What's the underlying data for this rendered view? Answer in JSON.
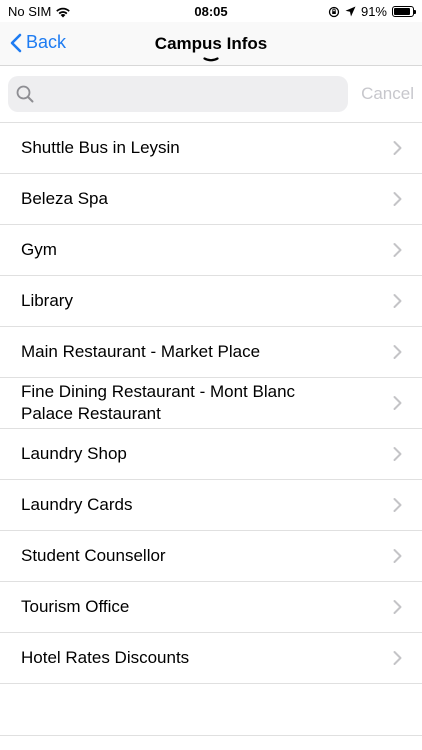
{
  "status_bar": {
    "carrier": "No SIM",
    "time": "08:05",
    "battery_percent": "91%",
    "battery_level": 0.91
  },
  "nav": {
    "back_label": "Back",
    "title": "Campus Infos"
  },
  "search": {
    "placeholder": "",
    "value": "",
    "cancel_label": "Cancel"
  },
  "list": {
    "items": [
      {
        "label": "Shuttle Bus in Leysin"
      },
      {
        "label": "Beleza Spa"
      },
      {
        "label": "Gym"
      },
      {
        "label": "Library"
      },
      {
        "label": "Main Restaurant - Market Place"
      },
      {
        "label": "Fine Dining Restaurant - Mont Blanc Palace Restaurant"
      },
      {
        "label": "Laundry Shop"
      },
      {
        "label": "Laundry Cards"
      },
      {
        "label": "Student Counsellor"
      },
      {
        "label": "Tourism Office"
      },
      {
        "label": "Hotel Rates Discounts"
      }
    ]
  },
  "colors": {
    "accent": "#1e7cf2",
    "disabled": "#c7c7cc",
    "chevron": "#c4c4c7"
  }
}
